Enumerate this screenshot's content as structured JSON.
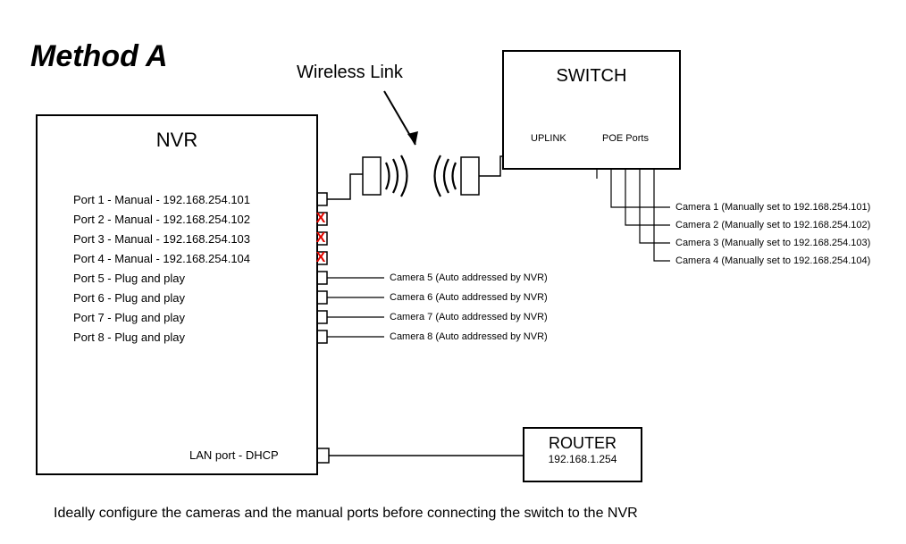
{
  "title": "Method A",
  "wireless_label": "Wireless Link",
  "nvr": {
    "title": "NVR",
    "ports": [
      "Port 1 - Manual - 192.168.254.101",
      "Port 2 - Manual - 192.168.254.102",
      "Port 3 - Manual - 192.168.254.103",
      "Port 4 - Manual - 192.168.254.104",
      "Port 5 - Plug and play",
      "Port 6 - Plug and play",
      "Port 7 - Plug and play",
      "Port 8 - Plug and play"
    ],
    "x_marks": [
      "X",
      "X",
      "X"
    ],
    "lan_label": "LAN port - DHCP"
  },
  "local_cameras": [
    "Camera 5 (Auto addressed by NVR)",
    "Camera 6 (Auto addressed by NVR)",
    "Camera 7 (Auto addressed by NVR)",
    "Camera 8 (Auto addressed by NVR)"
  ],
  "switch": {
    "title": "SWITCH",
    "uplink_label": "UPLINK",
    "poe_label": "POE Ports"
  },
  "remote_cameras": [
    "Camera 1 (Manually set to 192.168.254.101)",
    "Camera 2 (Manually set to 192.168.254.102)",
    "Camera 3 (Manually set to 192.168.254.103)",
    "Camera 4 (Manually set to 192.168.254.104)"
  ],
  "router": {
    "title": "ROUTER",
    "ip": "192.168.1.254"
  },
  "footer": "Ideally configure the cameras and the manual ports before connecting the switch to the NVR"
}
